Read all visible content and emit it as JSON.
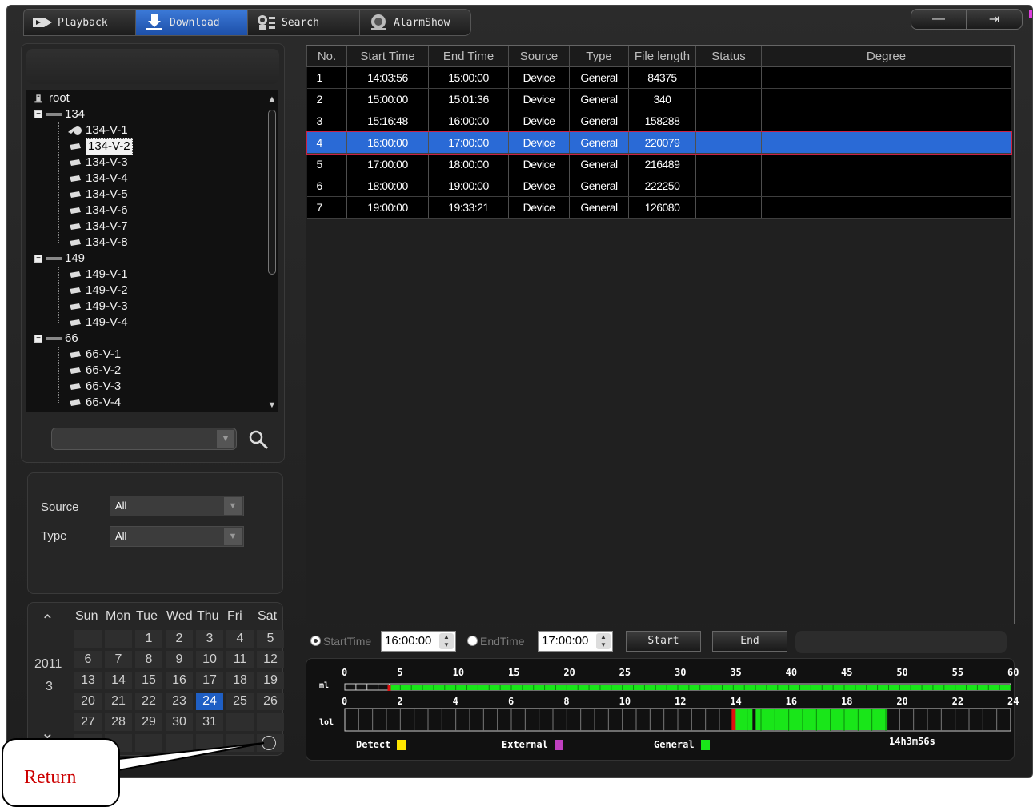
{
  "tabs": [
    {
      "label": "Playback",
      "icon": "playback-icon",
      "active": false
    },
    {
      "label": "Download",
      "icon": "download-icon",
      "active": true
    },
    {
      "label": "Search",
      "icon": "search-tab-icon",
      "active": false
    },
    {
      "label": "AlarmShow",
      "icon": "alarm-icon",
      "active": false
    }
  ],
  "window_controls": {
    "minimize": "—",
    "exit": "⇥"
  },
  "tree": {
    "root": "root",
    "groups": [
      {
        "name": "134",
        "children": [
          "134-V-1",
          "134-V-2",
          "134-V-3",
          "134-V-4",
          "134-V-5",
          "134-V-6",
          "134-V-7",
          "134-V-8"
        ]
      },
      {
        "name": "149",
        "children": [
          "149-V-1",
          "149-V-2",
          "149-V-3",
          "149-V-4"
        ]
      },
      {
        "name": "66",
        "children": [
          "66-V-1",
          "66-V-2",
          "66-V-3",
          "66-V-4"
        ]
      }
    ],
    "selected": "134-V-2"
  },
  "search": {
    "value": ""
  },
  "filters": {
    "source_label": "Source",
    "source_value": "All",
    "type_label": "Type",
    "type_value": "All"
  },
  "calendar": {
    "year": "2011",
    "month": "3",
    "weekdays": [
      "Sun",
      "Mon",
      "Tue",
      "Wed",
      "Thu",
      "Fri",
      "Sat"
    ],
    "weeks": [
      [
        "",
        "",
        "1",
        "2",
        "3",
        "4",
        "5"
      ],
      [
        "6",
        "7",
        "8",
        "9",
        "10",
        "11",
        "12"
      ],
      [
        "13",
        "14",
        "15",
        "16",
        "17",
        "18",
        "19"
      ],
      [
        "20",
        "21",
        "22",
        "23",
        "24",
        "25",
        "26"
      ],
      [
        "27",
        "28",
        "29",
        "30",
        "31",
        "",
        ""
      ],
      [
        "",
        "",
        "",
        "",
        "",
        "",
        ""
      ]
    ],
    "today": "24"
  },
  "callout": {
    "text": "Return"
  },
  "table": {
    "headers": [
      "No.",
      "Start Time",
      "End Time",
      "Source",
      "Type",
      "File length",
      "Status",
      "Degree"
    ],
    "rows": [
      [
        "1",
        "14:03:56",
        "15:00:00",
        "Device",
        "General",
        "84375",
        "",
        ""
      ],
      [
        "2",
        "15:00:00",
        "15:01:36",
        "Device",
        "General",
        "340",
        "",
        ""
      ],
      [
        "3",
        "15:16:48",
        "16:00:00",
        "Device",
        "General",
        "158288",
        "",
        ""
      ],
      [
        "4",
        "16:00:00",
        "17:00:00",
        "Device",
        "General",
        "220079",
        "",
        ""
      ],
      [
        "5",
        "17:00:00",
        "18:00:00",
        "Device",
        "General",
        "216489",
        "",
        ""
      ],
      [
        "6",
        "18:00:00",
        "19:00:00",
        "Device",
        "General",
        "222250",
        "",
        ""
      ],
      [
        "7",
        "19:00:00",
        "19:33:21",
        "Device",
        "General",
        "126080",
        "",
        ""
      ]
    ],
    "selected_row": 3
  },
  "time_controls": {
    "start_label": "StartTime",
    "start_value": "16:00:00",
    "end_label": "EndTime",
    "end_value": "17:00:00",
    "start_button": "Start",
    "end_button": "End"
  },
  "timeline": {
    "minute_ticks": [
      "0",
      "5",
      "10",
      "15",
      "20",
      "25",
      "30",
      "35",
      "40",
      "45",
      "50",
      "55",
      "60"
    ],
    "hour_ticks": [
      "0",
      "2",
      "4",
      "6",
      "8",
      "10",
      "12",
      "14",
      "16",
      "18",
      "20",
      "22",
      "24"
    ],
    "minute_row_label": "ml",
    "hour_row_label": "lol",
    "legend": [
      {
        "label": "Detect",
        "color": "#ffe600"
      },
      {
        "label": "External",
        "color": "#c040c0"
      },
      {
        "label": "General",
        "color": "#19e619"
      }
    ],
    "duration": "14h3m56s",
    "recorded_hours": [
      14.07,
      19.56
    ],
    "cursor_hour": 14.0,
    "minute_cursor": 4
  },
  "colors": {
    "accent": "#2a6ad6",
    "general": "#19e619",
    "marker": "#e01010"
  }
}
